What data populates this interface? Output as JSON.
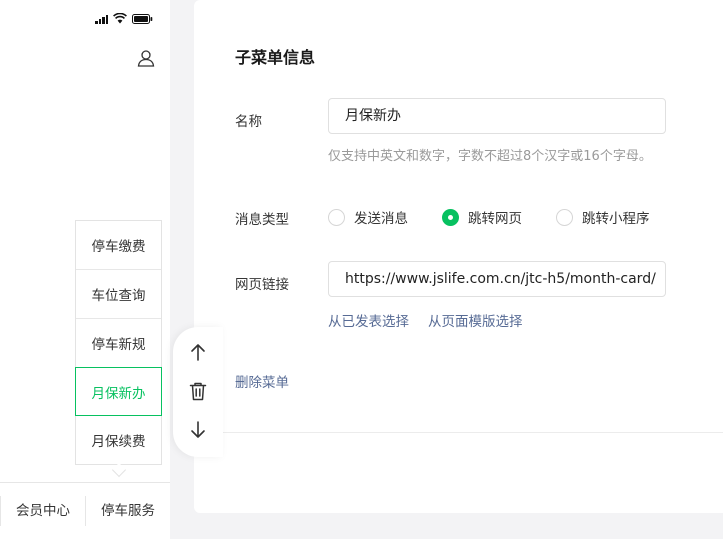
{
  "phone": {
    "submenu": [
      {
        "label": "停车缴费",
        "active": false
      },
      {
        "label": "车位查询",
        "active": false
      },
      {
        "label": "停车新规",
        "active": false
      },
      {
        "label": "月保新办",
        "active": true
      },
      {
        "label": "月保续费",
        "active": false
      }
    ],
    "menu": [
      {
        "label": "会员中心"
      },
      {
        "label": "停车服务"
      }
    ],
    "icons": {
      "signal": "signal-icon",
      "wifi": "wifi-icon",
      "battery": "battery-icon",
      "user": "user-icon"
    }
  },
  "tools": {
    "up": "arrow-up-icon",
    "delete": "trash-icon",
    "down": "arrow-down-icon"
  },
  "editor": {
    "title": "子菜单信息",
    "name_label": "名称",
    "name_value": "月保新办",
    "name_hint": "仅支持中英文和数字，字数不超过8个汉字或16个字母。",
    "type_label": "消息类型",
    "types": [
      {
        "label": "发送消息",
        "checked": false
      },
      {
        "label": "跳转网页",
        "checked": true
      },
      {
        "label": "跳转小程序",
        "checked": false
      }
    ],
    "link_label": "网页链接",
    "link_value": "https://www.jslife.com.cn/jtc-h5/month-card/",
    "link_from_published": "从已发表选择",
    "link_from_template": "从页面模版选择",
    "delete_label": "删除菜单"
  },
  "colors": {
    "accent": "#07c160",
    "link": "#576b95",
    "hint": "#9a9a9a"
  }
}
